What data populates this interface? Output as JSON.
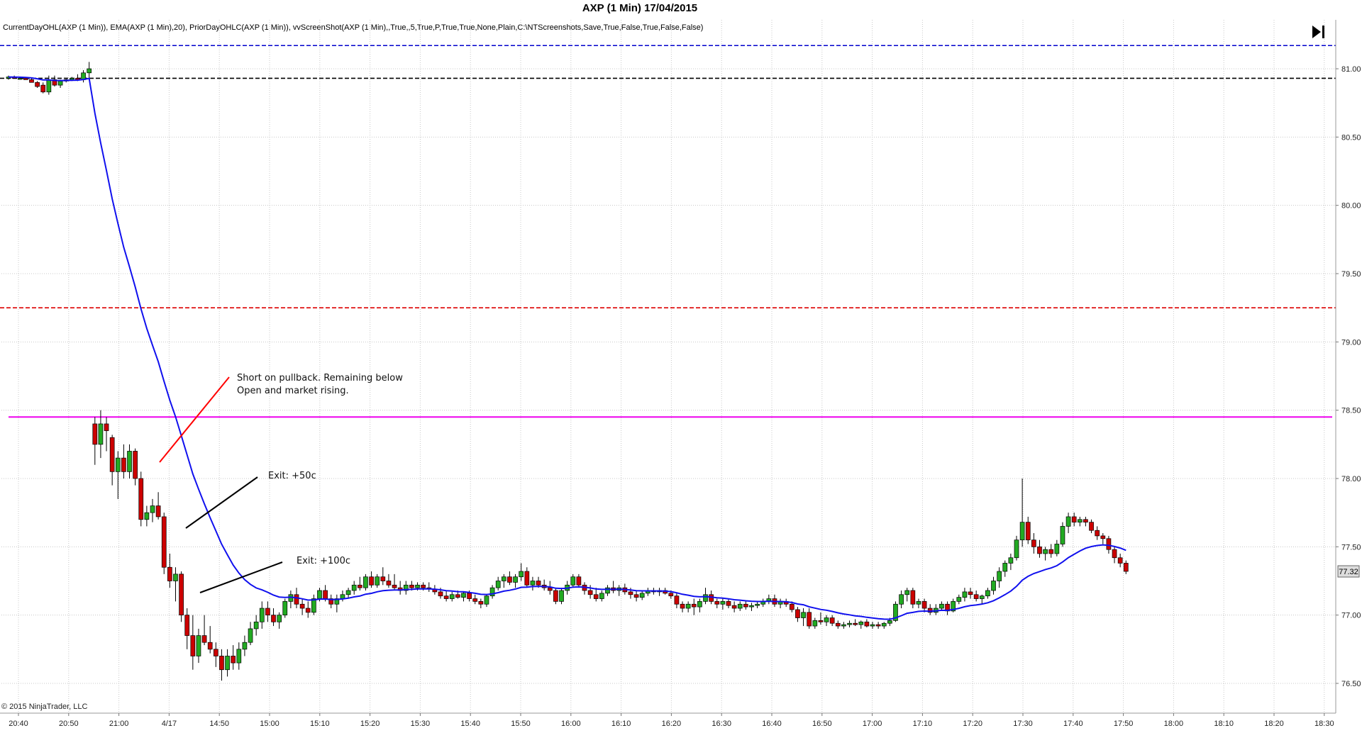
{
  "window": {
    "title": "AXP (1 Min)  17/04/2015",
    "indicators": "CurrentDayOHL(AXP (1 Min)), EMA(AXP (1 Min),20), PriorDayOHLC(AXP (1 Min)), vvScreenShot(AXP (1 Min),,True,,5,True,P,True,True,None,Plain,C:\\NTScreenshots,Save,True,False,True,False,False)",
    "copyright": "© 2015 NinjaTrader, LLC",
    "scroll_end_icon": "skip-to-end-icon"
  },
  "chart_data": {
    "type": "candlestick",
    "instrument": "AXP",
    "interval": "1 Min",
    "date": "17/04/2015",
    "ylim": [
      76.35,
      81.2
    ],
    "y_ticks": [
      "81.00",
      "80.50",
      "80.00",
      "79.50",
      "79.00",
      "78.50",
      "78.00",
      "77.50",
      "77.00",
      "76.50"
    ],
    "x_ticks": [
      "20:40",
      "20:50",
      "21:00",
      "4/17",
      "14:50",
      "15:00",
      "15:10",
      "15:20",
      "15:30",
      "15:40",
      "15:50",
      "16:00",
      "16:10",
      "16:20",
      "16:30",
      "16:40",
      "16:50",
      "17:00",
      "17:10",
      "17:20",
      "17:30",
      "17:40",
      "17:50",
      "18:00",
      "18:10",
      "18:20",
      "18:30"
    ],
    "last_price": "77.32",
    "grid": true,
    "horizontal_levels": [
      {
        "name": "prior-day-high",
        "value": 81.17,
        "color": "#0000cc",
        "style": "dashed"
      },
      {
        "name": "prior-day-close",
        "value": 80.93,
        "color": "#000000",
        "style": "dashed"
      },
      {
        "name": "prior-day-low",
        "value": 79.25,
        "color": "#dd0000",
        "style": "dashed"
      },
      {
        "name": "current-day-open",
        "value": 78.45,
        "color": "#ee00ee",
        "style": "solid"
      }
    ],
    "ema_color": "#1010ee",
    "up_color": "#22aa22",
    "down_color": "#cc0000",
    "candles": [
      [
        80.93,
        80.95,
        80.92,
        80.94
      ],
      [
        80.94,
        80.95,
        80.93,
        80.93
      ],
      [
        80.93,
        80.94,
        80.92,
        80.93
      ],
      [
        80.93,
        80.94,
        80.92,
        80.92
      ],
      [
        80.92,
        80.93,
        80.9,
        80.9
      ],
      [
        80.9,
        80.91,
        80.86,
        80.87
      ],
      [
        80.88,
        80.9,
        80.82,
        80.83
      ],
      [
        80.83,
        80.95,
        80.81,
        80.92
      ],
      [
        80.92,
        80.95,
        80.87,
        80.88
      ],
      [
        80.88,
        80.92,
        80.86,
        80.91
      ],
      [
        80.91,
        80.93,
        80.9,
        80.92
      ],
      [
        80.92,
        80.94,
        80.91,
        80.93
      ],
      [
        80.93,
        80.96,
        80.91,
        80.92
      ],
      [
        80.92,
        80.99,
        80.9,
        80.97
      ],
      [
        80.97,
        81.05,
        80.93,
        81.0
      ],
      [
        78.4,
        78.45,
        78.1,
        78.25
      ],
      [
        78.25,
        78.5,
        78.15,
        78.4
      ],
      [
        78.4,
        78.45,
        78.2,
        78.35
      ],
      [
        78.3,
        78.32,
        77.95,
        78.05
      ],
      [
        78.05,
        78.2,
        77.85,
        78.15
      ],
      [
        78.15,
        78.25,
        78.0,
        78.05
      ],
      [
        78.05,
        78.25,
        78.0,
        78.2
      ],
      [
        78.2,
        78.22,
        77.95,
        78.0
      ],
      [
        78.0,
        78.05,
        77.65,
        77.7
      ],
      [
        77.7,
        77.8,
        77.65,
        77.75
      ],
      [
        77.75,
        77.85,
        77.68,
        77.8
      ],
      [
        77.8,
        77.9,
        77.7,
        77.72
      ],
      [
        77.72,
        77.75,
        77.3,
        77.35
      ],
      [
        77.35,
        77.45,
        77.2,
        77.25
      ],
      [
        77.25,
        77.35,
        77.1,
        77.3
      ],
      [
        77.3,
        77.32,
        76.95,
        77.0
      ],
      [
        77.0,
        77.05,
        76.75,
        76.85
      ],
      [
        76.85,
        77.0,
        76.6,
        76.7
      ],
      [
        76.7,
        76.9,
        76.65,
        76.85
      ],
      [
        76.85,
        77.0,
        76.78,
        76.8
      ],
      [
        76.8,
        76.92,
        76.72,
        76.75
      ],
      [
        76.75,
        76.8,
        76.62,
        76.7
      ],
      [
        76.7,
        76.75,
        76.52,
        76.6
      ],
      [
        76.6,
        76.75,
        76.55,
        76.7
      ],
      [
        76.7,
        76.78,
        76.6,
        76.65
      ],
      [
        76.65,
        76.8,
        76.6,
        76.75
      ],
      [
        76.75,
        76.85,
        76.7,
        76.8
      ],
      [
        76.8,
        76.95,
        76.78,
        76.9
      ],
      [
        76.9,
        77.0,
        76.85,
        76.95
      ],
      [
        76.95,
        77.1,
        76.9,
        77.05
      ],
      [
        77.05,
        77.1,
        76.95,
        77.0
      ],
      [
        77.0,
        77.05,
        76.92,
        76.95
      ],
      [
        76.95,
        77.02,
        76.9,
        77.0
      ],
      [
        77.0,
        77.12,
        76.98,
        77.1
      ],
      [
        77.1,
        77.18,
        77.05,
        77.15
      ],
      [
        77.15,
        77.2,
        77.05,
        77.08
      ],
      [
        77.08,
        77.12,
        77.0,
        77.05
      ],
      [
        77.05,
        77.1,
        76.98,
        77.02
      ],
      [
        77.02,
        77.15,
        77.0,
        77.12
      ],
      [
        77.12,
        77.2,
        77.1,
        77.18
      ],
      [
        77.18,
        77.22,
        77.1,
        77.12
      ],
      [
        77.12,
        77.15,
        77.05,
        77.08
      ],
      [
        77.08,
        77.15,
        77.02,
        77.12
      ],
      [
        77.12,
        77.18,
        77.1,
        77.15
      ],
      [
        77.15,
        77.2,
        77.12,
        77.18
      ],
      [
        77.18,
        77.25,
        77.15,
        77.22
      ],
      [
        77.22,
        77.28,
        77.18,
        77.2
      ],
      [
        77.2,
        77.3,
        77.18,
        77.28
      ],
      [
        77.28,
        77.32,
        77.2,
        77.22
      ],
      [
        77.22,
        77.3,
        77.2,
        77.28
      ],
      [
        77.28,
        77.35,
        77.22,
        77.25
      ],
      [
        77.25,
        77.3,
        77.2,
        77.22
      ],
      [
        77.22,
        77.3,
        77.18,
        77.2
      ],
      [
        77.2,
        77.25,
        77.15,
        77.18
      ],
      [
        77.18,
        77.25,
        77.15,
        77.22
      ],
      [
        77.22,
        77.25,
        77.18,
        77.2
      ],
      [
        77.2,
        77.24,
        77.18,
        77.22
      ],
      [
        77.22,
        77.24,
        77.18,
        77.2
      ],
      [
        77.2,
        77.24,
        77.17,
        77.19
      ],
      [
        77.19,
        77.22,
        77.15,
        77.17
      ],
      [
        77.17,
        77.2,
        77.12,
        77.14
      ],
      [
        77.14,
        77.18,
        77.1,
        77.12
      ],
      [
        77.12,
        77.17,
        77.1,
        77.15
      ],
      [
        77.15,
        77.18,
        77.12,
        77.13
      ],
      [
        77.13,
        77.17,
        77.1,
        77.16
      ],
      [
        77.16,
        77.18,
        77.1,
        77.12
      ],
      [
        77.12,
        77.15,
        77.08,
        77.1
      ],
      [
        77.1,
        77.12,
        77.05,
        77.08
      ],
      [
        77.08,
        77.15,
        77.06,
        77.14
      ],
      [
        77.14,
        77.22,
        77.12,
        77.2
      ],
      [
        77.2,
        77.28,
        77.18,
        77.25
      ],
      [
        77.25,
        77.3,
        77.2,
        77.28
      ],
      [
        77.28,
        77.32,
        77.22,
        77.24
      ],
      [
        77.24,
        77.3,
        77.2,
        77.28
      ],
      [
        77.28,
        77.38,
        77.25,
        77.32
      ],
      [
        77.32,
        77.35,
        77.2,
        77.22
      ],
      [
        77.22,
        77.28,
        77.18,
        77.25
      ],
      [
        77.25,
        77.28,
        77.2,
        77.22
      ],
      [
        77.22,
        77.26,
        77.18,
        77.2
      ],
      [
        77.2,
        77.25,
        77.15,
        77.18
      ],
      [
        77.18,
        77.2,
        77.08,
        77.1
      ],
      [
        77.1,
        77.2,
        77.08,
        77.18
      ],
      [
        77.18,
        77.25,
        77.15,
        77.22
      ],
      [
        77.22,
        77.3,
        77.2,
        77.28
      ],
      [
        77.28,
        77.3,
        77.2,
        77.22
      ],
      [
        77.22,
        77.24,
        77.15,
        77.18
      ],
      [
        77.18,
        77.22,
        77.12,
        77.15
      ],
      [
        77.15,
        77.2,
        77.1,
        77.12
      ],
      [
        77.12,
        77.18,
        77.1,
        77.16
      ],
      [
        77.16,
        77.22,
        77.14,
        77.2
      ],
      [
        77.2,
        77.25,
        77.16,
        77.18
      ],
      [
        77.18,
        77.22,
        77.14,
        77.2
      ],
      [
        77.2,
        77.23,
        77.15,
        77.17
      ],
      [
        77.17,
        77.2,
        77.12,
        77.15
      ],
      [
        77.15,
        77.18,
        77.1,
        77.13
      ],
      [
        77.13,
        77.18,
        77.11,
        77.16
      ],
      [
        77.16,
        77.2,
        77.14,
        77.18
      ],
      [
        77.18,
        77.2,
        77.15,
        77.17
      ],
      [
        77.17,
        77.2,
        77.14,
        77.18
      ],
      [
        77.18,
        77.2,
        77.15,
        77.16
      ],
      [
        77.16,
        77.18,
        77.12,
        77.14
      ],
      [
        77.14,
        77.16,
        77.05,
        77.08
      ],
      [
        77.08,
        77.1,
        77.02,
        77.05
      ],
      [
        77.05,
        77.1,
        77.02,
        77.08
      ],
      [
        77.08,
        77.12,
        77.0,
        77.06
      ],
      [
        77.06,
        77.12,
        77.02,
        77.1
      ],
      [
        77.1,
        77.2,
        77.08,
        77.15
      ],
      [
        77.15,
        77.18,
        77.08,
        77.1
      ],
      [
        77.1,
        77.12,
        77.05,
        77.08
      ],
      [
        77.08,
        77.12,
        77.04,
        77.1
      ],
      [
        77.1,
        77.12,
        77.05,
        77.07
      ],
      [
        77.07,
        77.1,
        77.02,
        77.05
      ],
      [
        77.05,
        77.1,
        77.03,
        77.08
      ],
      [
        77.08,
        77.1,
        77.04,
        77.06
      ],
      [
        77.06,
        77.09,
        77.03,
        77.07
      ],
      [
        77.07,
        77.1,
        77.05,
        77.08
      ],
      [
        77.08,
        77.12,
        77.06,
        77.1
      ],
      [
        77.1,
        77.15,
        77.08,
        77.12
      ],
      [
        77.12,
        77.15,
        77.06,
        77.08
      ],
      [
        77.08,
        77.12,
        77.05,
        77.1
      ],
      [
        77.1,
        77.12,
        77.06,
        77.08
      ],
      [
        77.08,
        77.1,
        77.02,
        77.04
      ],
      [
        77.04,
        77.06,
        76.95,
        76.98
      ],
      [
        76.98,
        77.05,
        76.92,
        77.02
      ],
      [
        77.02,
        77.05,
        76.9,
        76.92
      ],
      [
        76.92,
        76.98,
        76.9,
        76.96
      ],
      [
        76.96,
        77.02,
        76.93,
        76.95
      ],
      [
        76.95,
        77.0,
        76.92,
        76.98
      ],
      [
        76.98,
        77.0,
        76.92,
        76.94
      ],
      [
        76.94,
        76.96,
        76.9,
        76.92
      ],
      [
        76.92,
        76.95,
        76.9,
        76.93
      ],
      [
        76.93,
        76.96,
        76.91,
        76.94
      ],
      [
        76.94,
        76.97,
        76.92,
        76.93
      ],
      [
        76.93,
        76.96,
        76.9,
        76.95
      ],
      [
        76.95,
        76.97,
        76.91,
        76.92
      ],
      [
        76.92,
        76.95,
        76.9,
        76.93
      ],
      [
        76.93,
        76.95,
        76.9,
        76.92
      ],
      [
        76.92,
        76.95,
        76.9,
        76.94
      ],
      [
        76.94,
        76.98,
        76.92,
        76.96
      ],
      [
        76.96,
        77.1,
        76.95,
        77.08
      ],
      [
        77.08,
        77.18,
        77.05,
        77.15
      ],
      [
        77.15,
        77.2,
        77.1,
        77.18
      ],
      [
        77.18,
        77.2,
        77.05,
        77.08
      ],
      [
        77.08,
        77.12,
        77.05,
        77.1
      ],
      [
        77.1,
        77.12,
        77.02,
        77.05
      ],
      [
        77.05,
        77.08,
        77.0,
        77.02
      ],
      [
        77.02,
        77.08,
        77.0,
        77.05
      ],
      [
        77.05,
        77.1,
        77.03,
        77.08
      ],
      [
        77.08,
        77.1,
        77.0,
        77.03
      ],
      [
        77.03,
        77.12,
        77.02,
        77.1
      ],
      [
        77.1,
        77.15,
        77.08,
        77.13
      ],
      [
        77.13,
        77.2,
        77.1,
        77.17
      ],
      [
        77.17,
        77.2,
        77.12,
        77.15
      ],
      [
        77.15,
        77.18,
        77.1,
        77.12
      ],
      [
        77.12,
        77.15,
        77.08,
        77.14
      ],
      [
        77.14,
        77.2,
        77.12,
        77.18
      ],
      [
        77.18,
        77.28,
        77.15,
        77.25
      ],
      [
        77.25,
        77.35,
        77.2,
        77.32
      ],
      [
        77.32,
        77.4,
        77.28,
        77.38
      ],
      [
        77.38,
        77.45,
        77.33,
        77.42
      ],
      [
        77.42,
        77.58,
        77.4,
        77.55
      ],
      [
        77.55,
        78.0,
        77.5,
        77.68
      ],
      [
        77.68,
        77.72,
        77.52,
        77.55
      ],
      [
        77.55,
        77.6,
        77.45,
        77.5
      ],
      [
        77.5,
        77.55,
        77.42,
        77.45
      ],
      [
        77.45,
        77.5,
        77.4,
        77.48
      ],
      [
        77.48,
        77.52,
        77.42,
        77.45
      ],
      [
        77.45,
        77.55,
        77.43,
        77.52
      ],
      [
        77.52,
        77.68,
        77.5,
        77.65
      ],
      [
        77.65,
        77.75,
        77.6,
        77.72
      ],
      [
        77.72,
        77.75,
        77.65,
        77.68
      ],
      [
        77.68,
        77.72,
        77.65,
        77.7
      ],
      [
        77.7,
        77.72,
        77.65,
        77.68
      ],
      [
        77.68,
        77.7,
        77.6,
        77.62
      ],
      [
        77.62,
        77.65,
        77.55,
        77.58
      ],
      [
        77.58,
        77.6,
        77.52,
        77.56
      ],
      [
        77.56,
        77.58,
        77.45,
        77.48
      ],
      [
        77.48,
        77.5,
        77.38,
        77.42
      ],
      [
        77.42,
        77.45,
        77.35,
        77.38
      ],
      [
        77.38,
        77.4,
        77.3,
        77.32
      ]
    ],
    "annotations": [
      {
        "lines": [
          "Short on pullback. Remaining below",
          "Open and market rising."
        ],
        "color": "#ff0000"
      },
      {
        "lines": [
          "Exit: +50c"
        ],
        "color": "#000000"
      },
      {
        "lines": [
          "Exit: +100c"
        ],
        "color": "#000000"
      }
    ]
  }
}
